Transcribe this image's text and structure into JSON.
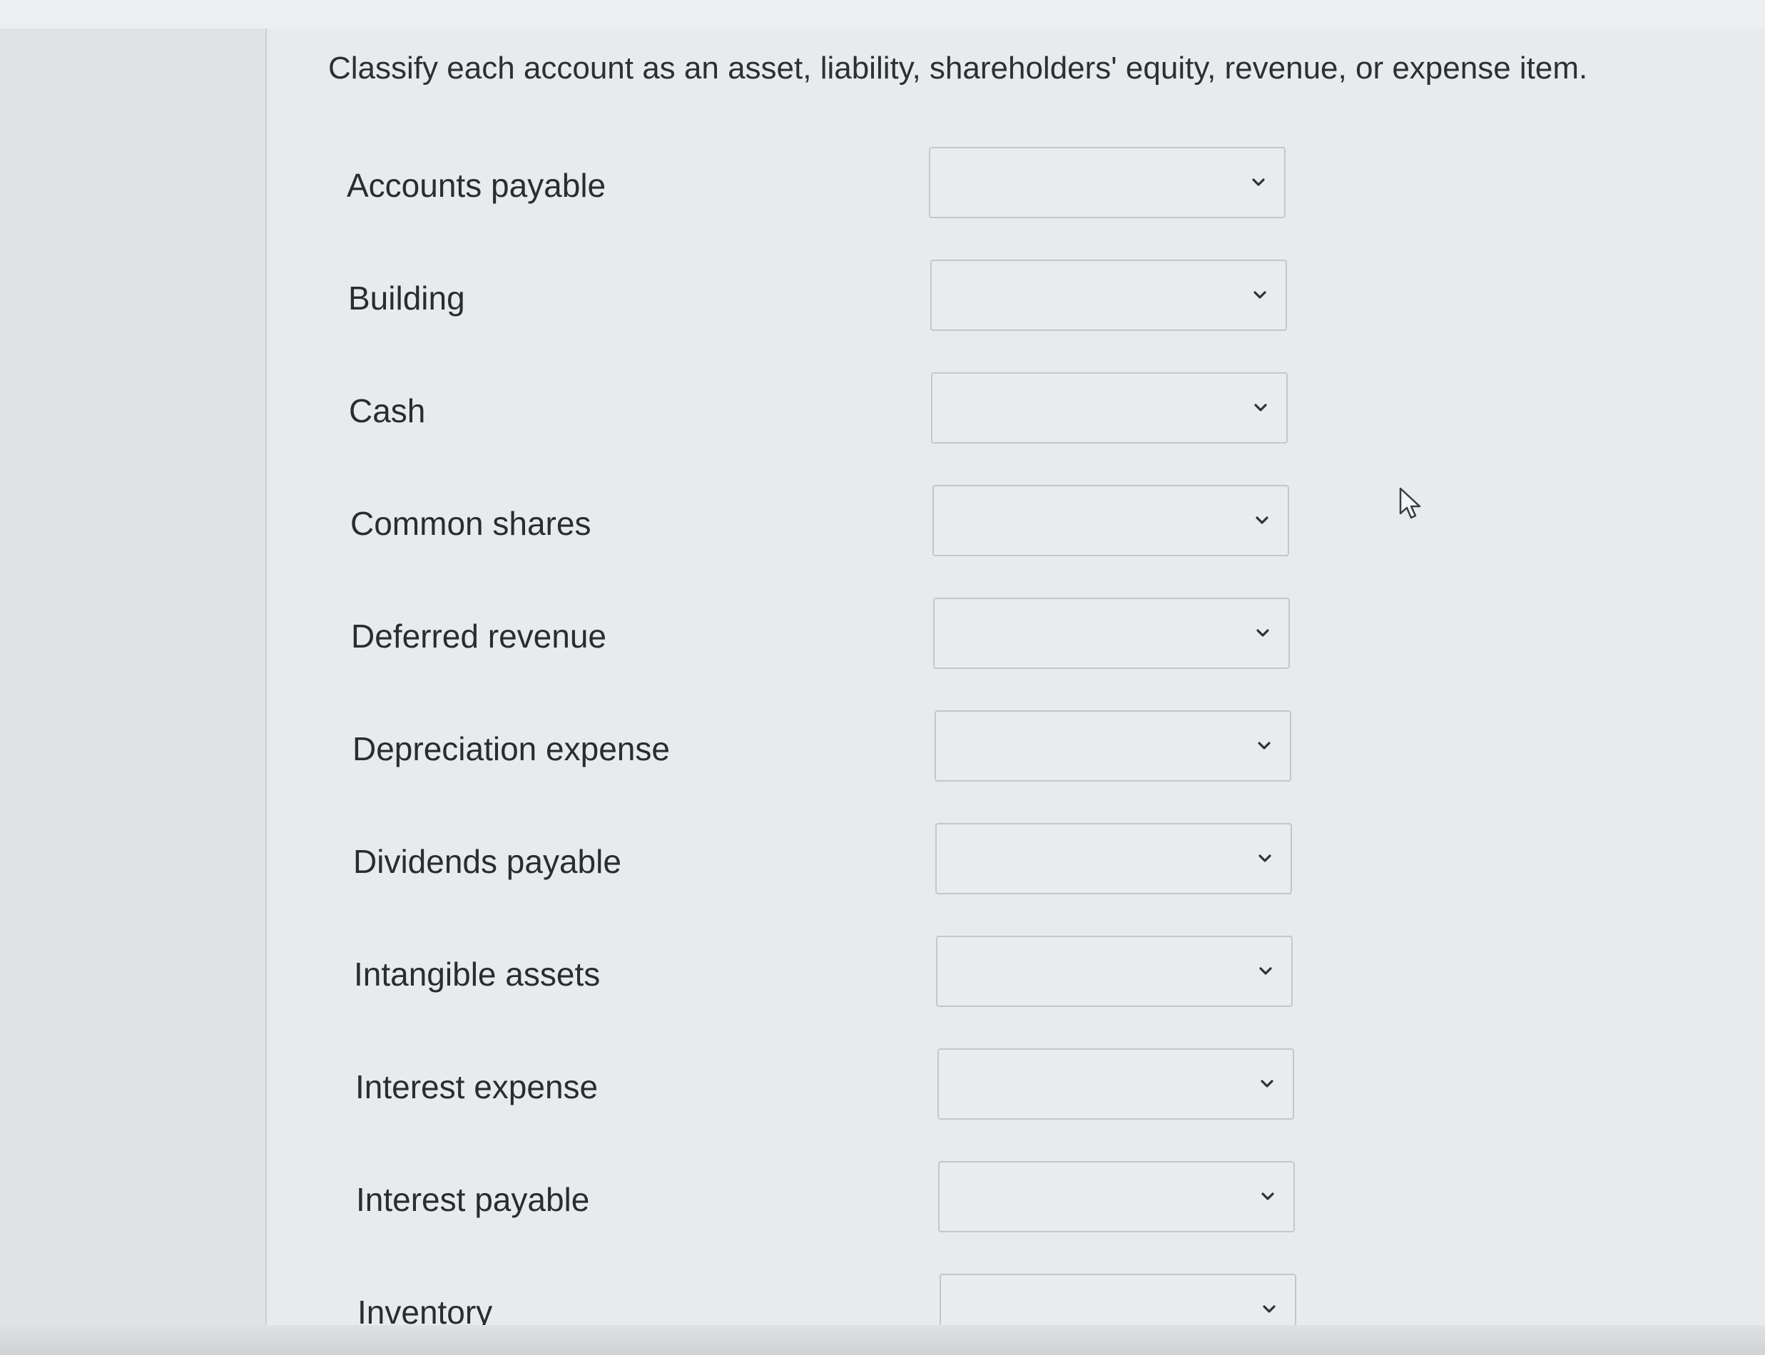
{
  "question": {
    "text": "Classify each account as an asset, liability, shareholders' equity, revenue, or expense item."
  },
  "dropdown": {
    "icon": "chevron-down-icon"
  },
  "accounts": [
    {
      "label": "Accounts payable",
      "selected": ""
    },
    {
      "label": "Building",
      "selected": ""
    },
    {
      "label": "Cash",
      "selected": ""
    },
    {
      "label": "Common shares",
      "selected": ""
    },
    {
      "label": "Deferred revenue",
      "selected": ""
    },
    {
      "label": "Depreciation expense",
      "selected": ""
    },
    {
      "label": "Dividends payable",
      "selected": ""
    },
    {
      "label": "Intangible assets",
      "selected": ""
    },
    {
      "label": "Interest expense",
      "selected": ""
    },
    {
      "label": "Interest payable",
      "selected": ""
    },
    {
      "label": "Inventory",
      "selected": ""
    }
  ],
  "cursor": {
    "icon": "mouse-pointer-icon"
  }
}
